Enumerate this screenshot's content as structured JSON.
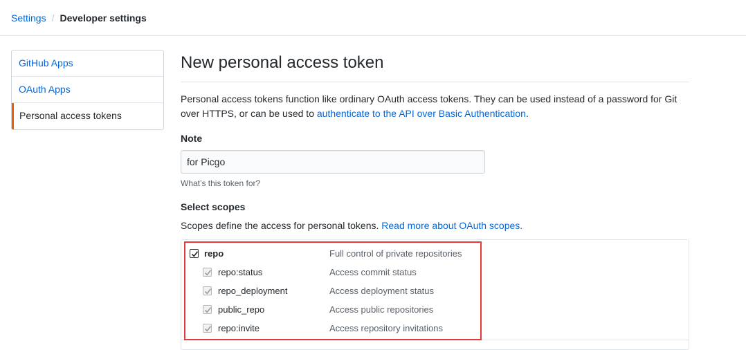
{
  "breadcrumb": {
    "root": "Settings",
    "separator": "/",
    "current": "Developer settings"
  },
  "sidebar": {
    "items": [
      {
        "label": "GitHub Apps",
        "selected": false
      },
      {
        "label": "OAuth Apps",
        "selected": false
      },
      {
        "label": "Personal access tokens",
        "selected": true
      }
    ]
  },
  "page": {
    "title": "New personal access token",
    "intro_text": "Personal access tokens function like ordinary OAuth access tokens. They can be used instead of a password for Git over HTTPS, or can be used to ",
    "intro_link": "authenticate to the API over Basic Authentication",
    "intro_end": "."
  },
  "note": {
    "label": "Note",
    "value": "for Picgo",
    "hint": "What’s this token for?"
  },
  "scopes": {
    "label": "Select scopes",
    "description": "Scopes define the access for personal tokens. ",
    "link": "Read more about OAuth scopes.",
    "items": [
      {
        "name": "repo",
        "description": "Full control of private repositories",
        "checked": true
      },
      {
        "name": "repo:status",
        "description": "Access commit status",
        "checked": true
      },
      {
        "name": "repo_deployment",
        "description": "Access deployment status",
        "checked": true
      },
      {
        "name": "public_repo",
        "description": "Access public repositories",
        "checked": true
      },
      {
        "name": "repo:invite",
        "description": "Access repository invitations",
        "checked": true
      }
    ]
  },
  "colors": {
    "link": "#0366d6",
    "selected_accent": "#e36209",
    "highlight": "#e5383b"
  }
}
